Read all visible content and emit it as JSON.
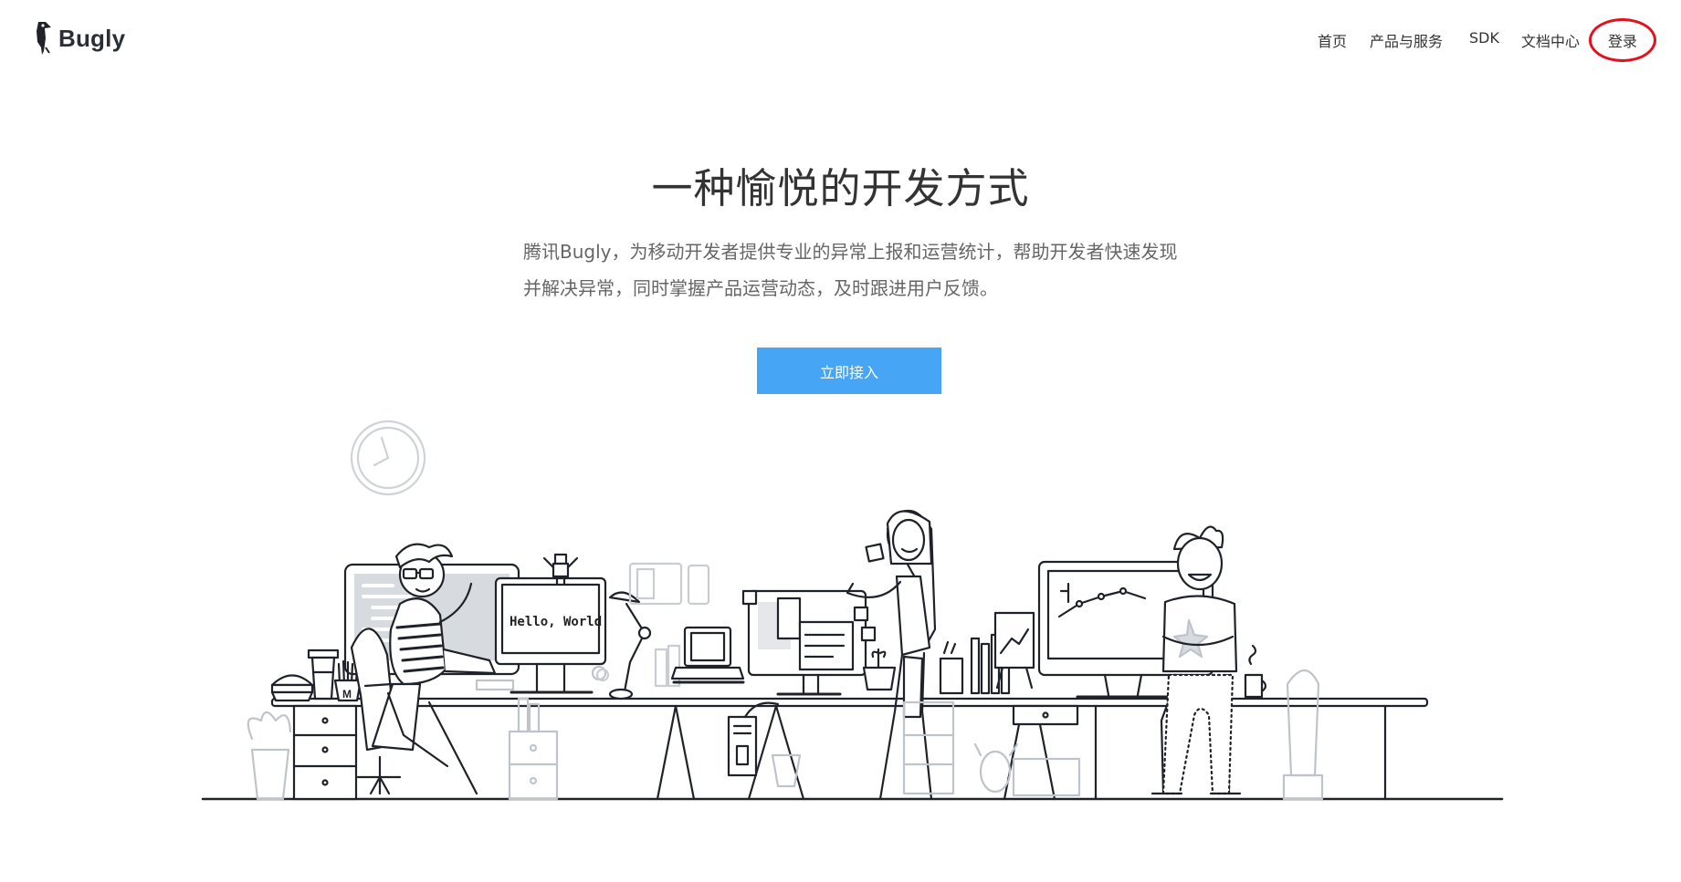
{
  "brand": {
    "name": "Bugly",
    "logo_icon": "woodpecker-icon"
  },
  "nav": {
    "items": [
      {
        "label": "首页"
      },
      {
        "label": "产品与服务"
      },
      {
        "label": "SDK"
      },
      {
        "label": "文档中心"
      },
      {
        "label": "登录"
      }
    ]
  },
  "hero": {
    "title": "一种愉悦的开发方式",
    "description_line1": "腾讯Bugly，为移动开发者提供专业的异常上报和运营统计，帮助开发者快速发现",
    "description_line2": "并解决异常，同时掌握产品运营动态，及时跟进用户反馈。",
    "cta_label": "立即接入"
  },
  "illustration": {
    "monitor_text": "Hello, World",
    "bag_letter": "M",
    "accent_color": "#46a6f5",
    "highlight_color": "#e3101e"
  }
}
